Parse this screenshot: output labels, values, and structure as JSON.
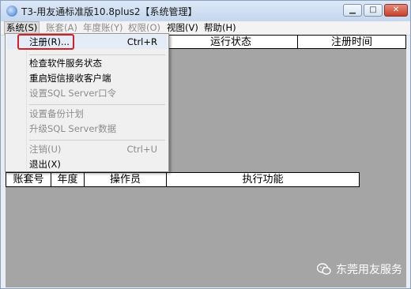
{
  "titlebar": {
    "title": "T3-用友通标准版10.8plus2【系统管理】",
    "minimize_glyph": "▁",
    "maximize_glyph": "□",
    "close_glyph": "✕"
  },
  "menubar": {
    "items": [
      {
        "label": "系统(S)",
        "state": "active"
      },
      {
        "label": "账套(A)",
        "state": "disabled"
      },
      {
        "label": "年度账(Y)",
        "state": "disabled"
      },
      {
        "label": "权限(O)",
        "state": "disabled"
      },
      {
        "label": "视图(V)",
        "state": "enabled"
      },
      {
        "label": "帮助(H)",
        "state": "enabled"
      }
    ]
  },
  "system_menu": {
    "items": [
      {
        "label": "注册(R)...",
        "shortcut": "Ctrl+R",
        "enabled": true,
        "highlighted": true
      },
      {
        "label": "检查软件服务状态",
        "shortcut": "",
        "enabled": true
      },
      {
        "label": "重启短信接收客户端",
        "shortcut": "",
        "enabled": true
      },
      {
        "label": "设置SQL Server口令",
        "shortcut": "",
        "enabled": false
      },
      {
        "label": "设置备份计划",
        "shortcut": "",
        "enabled": false
      },
      {
        "label": "升级SQL Server数据",
        "shortcut": "",
        "enabled": false
      },
      {
        "label": "注销(U)",
        "shortcut": "Ctrl+U",
        "enabled": false
      },
      {
        "label": "退出(X)",
        "shortcut": "",
        "enabled": true
      }
    ]
  },
  "upper_table": {
    "columns": [
      "运行状态",
      "注册时间"
    ]
  },
  "lower_table": {
    "columns": [
      "账套号",
      "年度",
      "操作员",
      "执行功能"
    ]
  },
  "watermark": {
    "text": "东莞用友服务"
  },
  "colors": {
    "client_area": "#a5a5a5",
    "highlight_box": "#d42020"
  }
}
